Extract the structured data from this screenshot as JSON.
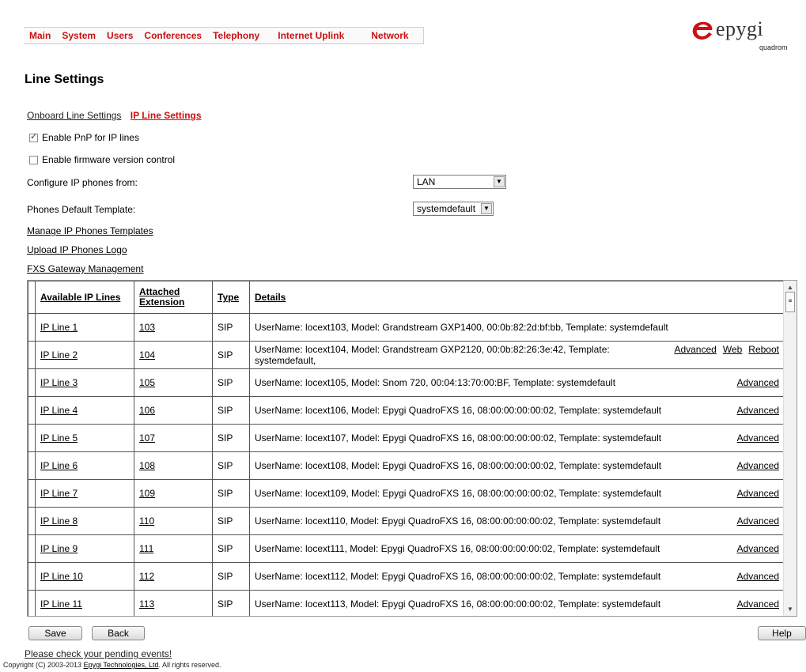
{
  "menu": [
    "Main",
    "System",
    "Users",
    "Conferences",
    "Telephony",
    "Internet Uplink",
    "Network"
  ],
  "logo": {
    "word": "epygi",
    "sub": "quadrom"
  },
  "page_title": "Line Settings",
  "tabs": {
    "onboard": "Onboard Line Settings",
    "ip": "IP Line Settings"
  },
  "options": {
    "pnp": {
      "label": "Enable PnP for IP lines",
      "checked": true
    },
    "fw": {
      "label": "Enable firmware version control",
      "checked": false
    }
  },
  "config_from": {
    "label": "Configure IP phones from:",
    "value": "LAN"
  },
  "default_template": {
    "label": "Phones Default Template:",
    "value": "systemdefault"
  },
  "links": {
    "manage": "Manage IP Phones Templates",
    "upload": "Upload IP Phones Logo",
    "fxs": "FXS Gateway Management"
  },
  "table": {
    "headers": {
      "lines": "Available IP Lines",
      "ext1": "Attached",
      "ext2": "Extension",
      "type": "Type",
      "details": "Details"
    },
    "rows": [
      {
        "line": "IP Line 1",
        "ext": "103",
        "type": "SIP",
        "details": "UserName: locext103, Model: Grandstream GXP1400, 00:0b:82:2d:bf:bb, Template: systemdefault",
        "actions": []
      },
      {
        "line": "IP Line 2",
        "ext": "104",
        "type": "SIP",
        "details": "UserName: locext104, Model: Grandstream GXP2120, 00:0b:82:26:3e:42, Template: systemdefault,",
        "actions": [
          "Advanced",
          "Web",
          "Reboot"
        ]
      },
      {
        "line": "IP Line 3",
        "ext": "105",
        "type": "SIP",
        "details": "UserName: locext105, Model: Snom 720, 00:04:13:70:00:BF, Template: systemdefault",
        "actions": [
          "Advanced"
        ]
      },
      {
        "line": "IP Line 4",
        "ext": "106",
        "type": "SIP",
        "details": "UserName: locext106, Model: Epygi QuadroFXS 16, 08:00:00:00:00:02, Template: systemdefault",
        "actions": [
          "Advanced"
        ]
      },
      {
        "line": "IP Line 5",
        "ext": "107",
        "type": "SIP",
        "details": "UserName: locext107, Model: Epygi QuadroFXS 16, 08:00:00:00:00:02, Template: systemdefault",
        "actions": [
          "Advanced"
        ]
      },
      {
        "line": "IP Line 6",
        "ext": "108",
        "type": "SIP",
        "details": "UserName: locext108, Model: Epygi QuadroFXS 16, 08:00:00:00:00:02, Template: systemdefault",
        "actions": [
          "Advanced"
        ]
      },
      {
        "line": "IP Line 7",
        "ext": "109",
        "type": "SIP",
        "details": "UserName: locext109, Model: Epygi QuadroFXS 16, 08:00:00:00:00:02, Template: systemdefault",
        "actions": [
          "Advanced"
        ]
      },
      {
        "line": "IP Line 8",
        "ext": "110",
        "type": "SIP",
        "details": "UserName: locext110, Model: Epygi QuadroFXS 16, 08:00:00:00:00:02, Template: systemdefault",
        "actions": [
          "Advanced"
        ]
      },
      {
        "line": "IP Line 9",
        "ext": "111",
        "type": "SIP",
        "details": "UserName: locext111, Model: Epygi QuadroFXS 16, 08:00:00:00:00:02, Template: systemdefault",
        "actions": [
          "Advanced"
        ]
      },
      {
        "line": "IP Line 10",
        "ext": "112",
        "type": "SIP",
        "details": "UserName: locext112, Model: Epygi QuadroFXS 16, 08:00:00:00:00:02, Template: systemdefault",
        "actions": [
          "Advanced"
        ]
      },
      {
        "line": "IP Line 11",
        "ext": "113",
        "type": "SIP",
        "details": "UserName: locext113, Model: Epygi QuadroFXS 16, 08:00:00:00:00:02, Template: systemdefault",
        "actions": [
          "Advanced"
        ]
      }
    ]
  },
  "buttons": {
    "save": "Save",
    "back": "Back",
    "help": "Help"
  },
  "pending": "Please check your pending events!",
  "copyright": {
    "pre": "Copyright (C) 2003-2013 ",
    "company": "Epygi Technologies, Ltd",
    "post": ". All rights reserved."
  },
  "colors": {
    "accent": "#cc1111"
  }
}
